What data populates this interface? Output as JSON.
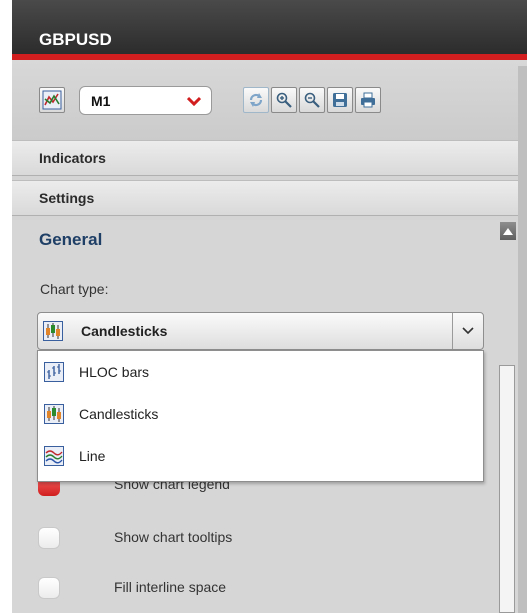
{
  "window": {
    "title": "GBPUSD"
  },
  "toolbar": {
    "timeframe": "M1",
    "buttons": [
      {
        "icon": "chart-type-icon"
      },
      {
        "icon": "refresh-icon"
      },
      {
        "icon": "zoom-in-icon"
      },
      {
        "icon": "zoom-out-icon"
      },
      {
        "icon": "save-icon"
      },
      {
        "icon": "print-icon"
      }
    ]
  },
  "accordion": {
    "indicators_label": "Indicators",
    "settings_label": "Settings"
  },
  "settings": {
    "section_title": "General",
    "chart_type_label": "Chart type:",
    "chart_type_selected": "Candlesticks",
    "chart_type_options": [
      "HLOC bars",
      "Candlesticks",
      "Line"
    ],
    "checkboxes": [
      {
        "label": "Show chart legend",
        "checked": true
      },
      {
        "label": "Show chart tooltips",
        "checked": false
      },
      {
        "label": "Fill interline space",
        "checked": false
      }
    ]
  },
  "colors": {
    "accent": "#d21e1e",
    "title_bar": "#333333",
    "section_title": "#1f3f66"
  }
}
